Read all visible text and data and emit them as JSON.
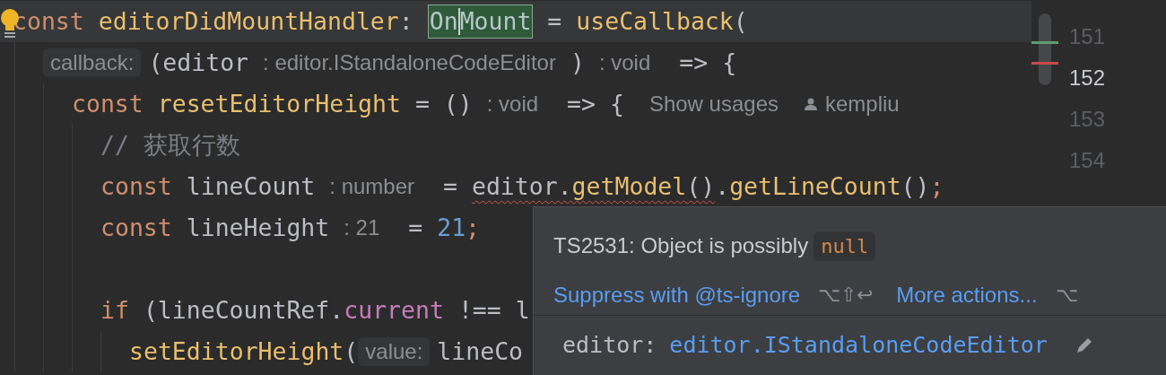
{
  "editor": {
    "lines": [
      {
        "kind": "code",
        "current": true,
        "tokens": [
          {
            "text": "const",
            "kind": "keyword"
          },
          {
            "text": " editorDidMountHandler",
            "kind": "function"
          },
          {
            "text": ": ",
            "kind": "plain"
          },
          {
            "kind": "match",
            "parts": [
              {
                "text": "On"
              },
              {
                "caret": true
              },
              {
                "text": "Mount"
              }
            ]
          },
          {
            "text": " = ",
            "kind": "plain"
          },
          {
            "text": "useCallback",
            "kind": "function"
          },
          {
            "text": "(",
            "kind": "plain"
          }
        ],
        "children": [
          {
            "kind": "code",
            "current": false,
            "tokens": [
              {
                "text": "callback:",
                "kind": "hint",
                "boxed": true
              },
              {
                "text": "(editor",
                "kind": "plain"
              },
              {
                "text": ": editor.IStandaloneCodeEditor",
                "kind": "hint",
                "boxed": false
              },
              {
                "text": ")",
                "kind": "plain"
              },
              {
                "text": ": void",
                "kind": "hint",
                "boxed": false
              },
              {
                "text": " => {",
                "kind": "plain"
              }
            ],
            "children": [
              {
                "kind": "code",
                "current": false,
                "tokens": [
                  {
                    "text": "const",
                    "kind": "keyword"
                  },
                  {
                    "text": " resetEditorHeight",
                    "kind": "function"
                  },
                  {
                    "text": " = ()",
                    "kind": "plain"
                  },
                  {
                    "text": ": void",
                    "kind": "hint",
                    "boxed": false
                  },
                  {
                    "text": " => {",
                    "kind": "plain"
                  },
                  {
                    "text": "Show usages",
                    "kind": "lens"
                  },
                  {
                    "text": "kempliu",
                    "kind": "author"
                  }
                ],
                "children": [
                  {
                    "kind": "code",
                    "current": false,
                    "tokens": [
                      {
                        "text": "// 获取行数",
                        "kind": "comment"
                      }
                    ]
                  },
                  {
                    "kind": "code",
                    "current": false,
                    "tokens": [
                      {
                        "text": "const",
                        "kind": "keyword"
                      },
                      {
                        "text": " lineCount",
                        "kind": "plain"
                      },
                      {
                        "text": ": number",
                        "kind": "hint",
                        "boxed": false
                      },
                      {
                        "text": " = ",
                        "kind": "plain"
                      },
                      {
                        "text": "editor.",
                        "kind": "plain",
                        "error": true
                      },
                      {
                        "text": "getModel",
                        "kind": "function",
                        "error": true
                      },
                      {
                        "text": "()",
                        "kind": "plain",
                        "error": true
                      },
                      {
                        "text": ".",
                        "kind": "plain"
                      },
                      {
                        "text": "getLineCount",
                        "kind": "function"
                      },
                      {
                        "text": "()",
                        "kind": "plain"
                      },
                      {
                        "text": ";",
                        "kind": "punct"
                      }
                    ]
                  },
                  {
                    "kind": "code",
                    "current": false,
                    "tokens": [
                      {
                        "text": "const",
                        "kind": "keyword"
                      },
                      {
                        "text": " lineHeight",
                        "kind": "plain"
                      },
                      {
                        "text": ": 21",
                        "kind": "hint",
                        "boxed": false
                      },
                      {
                        "text": " = ",
                        "kind": "plain"
                      },
                      {
                        "text": "21",
                        "kind": "number"
                      },
                      {
                        "text": ";",
                        "kind": "punct"
                      }
                    ]
                  },
                  {
                    "kind": "blank",
                    "current": false
                  },
                  {
                    "kind": "code",
                    "current": false,
                    "tokens": [
                      {
                        "text": "if",
                        "kind": "keyword"
                      },
                      {
                        "text": " (lineCountRef.",
                        "kind": "plain"
                      },
                      {
                        "text": "current",
                        "kind": "property"
                      },
                      {
                        "text": " !== l",
                        "kind": "plain"
                      }
                    ],
                    "children": [
                      {
                        "kind": "code",
                        "current": false,
                        "tokens": [
                          {
                            "text": "setEditorHeight",
                            "kind": "function"
                          },
                          {
                            "text": "(",
                            "kind": "plain"
                          },
                          {
                            "text": "value:",
                            "kind": "hint",
                            "boxed": true
                          },
                          {
                            "text": "lineCo",
                            "kind": "plain"
                          }
                        ]
                      }
                    ]
                  }
                ]
              }
            ]
          }
        ]
      }
    ]
  },
  "gutter": [
    {
      "number": "151",
      "selected": false
    },
    {
      "number": "152",
      "selected": true
    },
    {
      "number": "153",
      "selected": false
    },
    {
      "number": "154",
      "selected": false
    }
  ],
  "popup": {
    "message": "TS2531: Object is possibly",
    "code": "null",
    "actions": [
      {
        "label": "Suppress with @ts-ignore",
        "shortcut": "⌥⇧↩"
      },
      {
        "label": "More actions...",
        "shortcut": "⌥"
      }
    ],
    "signature": {
      "name": "editor:",
      "type": "editor.IStandaloneCodeEditor"
    }
  }
}
